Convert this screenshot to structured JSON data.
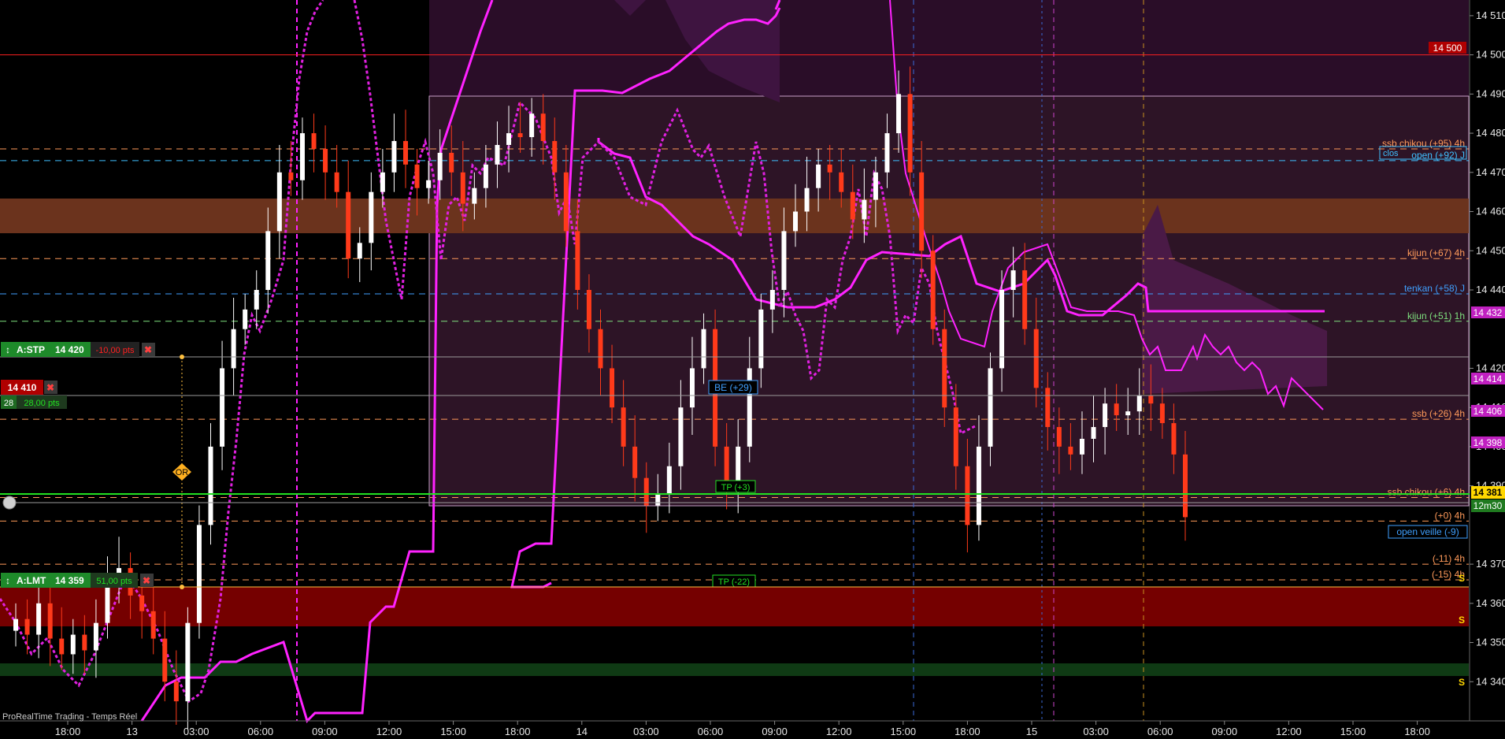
{
  "chart_data": {
    "type": "candlestick",
    "ylim": [
      14330,
      14514
    ],
    "y_ticks": [
      14340,
      14350,
      14360,
      14370,
      14390,
      14400,
      14410,
      14420,
      14440,
      14450,
      14460,
      14470,
      14480,
      14490,
      14500,
      14510
    ],
    "x_ticks": [
      "18:00",
      "13",
      "03:00",
      "06:00",
      "09:00",
      "12:00",
      "15:00",
      "18:00",
      "14",
      "03:00",
      "06:00",
      "09:00",
      "12:00",
      "15:00",
      "18:00",
      "15",
      "03:00",
      "06:00",
      "09:00",
      "12:00",
      "15:00",
      "18:00"
    ],
    "grid": false,
    "colors": {
      "background": "#000000",
      "bull": "#ffffff",
      "bear": "#ff3a1a",
      "kijun": "#ff22ff",
      "chikou": "#e020e0",
      "cloud": "#7a2a6e",
      "tp_line": "#22e022",
      "lmt_band": "#7a0000",
      "orange_band": "#7a3a1f",
      "green_band": "#0f3a14"
    },
    "closes": [
      14356,
      14352,
      14360,
      14351,
      14347,
      14352,
      14348,
      14355,
      14365,
      14369,
      14362,
      14358,
      14351,
      14340,
      14335,
      14355,
      14380,
      14400,
      14420,
      14430,
      14435,
      14440,
      14455,
      14470,
      14468,
      14480,
      14476,
      14470,
      14465,
      14448,
      14452,
      14465,
      14470,
      14478,
      14472,
      14466,
      14468,
      14475,
      14470,
      14462,
      14466,
      14472,
      14477,
      14480,
      14479,
      14485,
      14478,
      14470,
      14455,
      14440,
      14430,
      14420,
      14410,
      14400,
      14392,
      14385,
      14388,
      14395,
      14410,
      14420,
      14430,
      14400,
      14390,
      14400,
      14420,
      14435,
      14440,
      14455,
      14460,
      14466,
      14472,
      14470,
      14465,
      14458,
      14463,
      14470,
      14480,
      14490,
      14470,
      14450,
      14430,
      14410,
      14395,
      14380,
      14400,
      14420,
      14440,
      14445,
      14430,
      14415,
      14405,
      14400,
      14398,
      14402,
      14405,
      14411,
      14408,
      14409,
      14413,
      14411,
      14406,
      14398,
      14382
    ],
    "levels": [
      {
        "price": 14500,
        "text": "14 500"
      },
      {
        "price": 14476,
        "text": "ssb chikou (+95) 4h"
      },
      {
        "price": 14473,
        "text": "open (+92) J"
      },
      {
        "price": 14448,
        "text": "kijun (+67) 4h"
      },
      {
        "price": 14439,
        "text": "tenkan (+58) J"
      },
      {
        "price": 14432,
        "text": "kijun (+51) 1h"
      },
      {
        "price": 14407,
        "text": "ssb (+26) 4h"
      },
      {
        "price": 14387,
        "text": "ssb chikou (+6) 4h"
      },
      {
        "price": 14381,
        "text": "(+0) 4h"
      },
      {
        "price": 14370,
        "text": "(-11) 4h"
      },
      {
        "price": 14366,
        "text": "(-15) 4h"
      }
    ]
  },
  "axis_tags": {
    "t14500": "14 500",
    "t14432": "14 432",
    "t14414": "14 414",
    "t14406": "14 406",
    "t14398": "14 398",
    "t14381": "14 381",
    "timer": "12m30"
  },
  "level_labels": {
    "open_veille": "open veille (-9)",
    "clos": "clos",
    "be": "BE (+29)",
    "tp_up": "TP (+3)",
    "tp_down": "TP (-22)",
    "s1": "S",
    "s2": "S",
    "s3": "S"
  },
  "orders": {
    "stp": {
      "label": "A:STP",
      "price": "14 420",
      "pts": "-10,00 pts"
    },
    "pos": {
      "price": "14 410",
      "qty": "28",
      "pts": "28,00 pts"
    },
    "lmt": {
      "label": "A:LMT",
      "price": "14 359",
      "pts": "51,00 pts"
    },
    "marker": "OR"
  },
  "watermark": "ProRealTime Trading - Temps Réel"
}
